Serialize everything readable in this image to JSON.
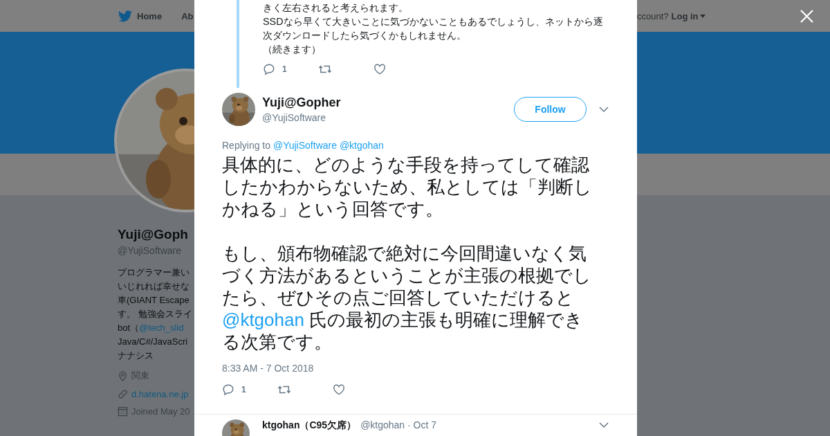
{
  "header": {
    "nav": [
      {
        "label": "Home",
        "kind": "home"
      },
      {
        "label": "Ab",
        "kind": "plain"
      }
    ],
    "account_prompt": "ccount?",
    "login": "Log in"
  },
  "profile": {
    "name": "Yuji@Goph",
    "handle": "@YujiSoftware",
    "bio_lines": [
      {
        "parts": [
          {
            "kind": "text",
            "text": "プログラマー兼い"
          }
        ]
      },
      {
        "parts": [
          {
            "kind": "text",
            "text": "いじれれば幸せな"
          }
        ]
      },
      {
        "parts": [
          {
            "kind": "text",
            "text": "車(GIANT Escape"
          }
        ]
      },
      {
        "parts": [
          {
            "kind": "text",
            "text": "す。 勉強会スライ"
          }
        ]
      },
      {
        "parts": [
          {
            "kind": "text",
            "text": "bot（"
          },
          {
            "kind": "mention",
            "text": "@tech_slid"
          }
        ]
      },
      {
        "parts": [
          {
            "kind": "text",
            "text": "Java/C#/JavaScri"
          }
        ]
      },
      {
        "parts": [
          {
            "kind": "text",
            "text": "ナナシス"
          }
        ]
      }
    ],
    "location": "関東",
    "website": "d.hatena.ne.jp",
    "joined": "Joined May 20"
  },
  "parent_tweet": {
    "lines": [
      "きく左右されると考えられます。",
      "SSDなら早くて大きいことに気づかないこともあるでしょうし、ネットから逐次ダウンロードしたら気づくかもしれません。",
      "（続きます）"
    ],
    "reply_count": "1"
  },
  "tweet": {
    "name": "Yuji@Gopher",
    "handle": "@YujiSoftware",
    "follow": "Follow",
    "replying_label": "Replying to",
    "replying_to": [
      "@YujiSoftware",
      "@ktgohan"
    ],
    "paragraphs": [
      {
        "parts": [
          {
            "kind": "text",
            "text": "具体的に、どのような手段を持ってして確認したかわからないため、私としては「判断しかねる」という回答です。"
          }
        ]
      },
      {
        "parts": [
          {
            "kind": "text",
            "text": "もし、頒布物確認で絶対に今回間違いなく気づく方法があるということが主張の根拠でしたら、ぜひその点ご回答していただけると"
          },
          {
            "kind": "mention",
            "text": "@ktgohan"
          },
          {
            "kind": "text",
            "text": " 氏の最初の主張も明確に理解できる次第です。"
          }
        ]
      }
    ],
    "timestamp": "8:33 AM - 7 Oct 2018",
    "reply_count": "1"
  },
  "next_reply": {
    "name": "ktgohan（C95欠席）",
    "handle": "@ktgohan",
    "date": "· Oct 7"
  }
}
